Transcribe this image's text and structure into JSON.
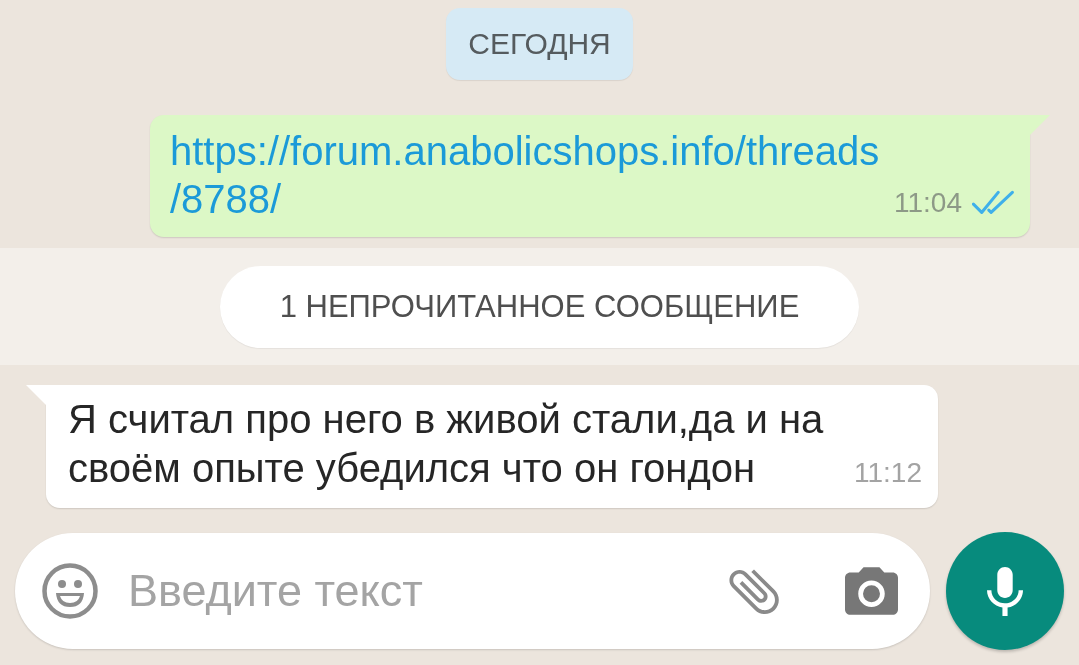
{
  "chat": [
    {
      "kind": "date_chip",
      "label": "СЕГОДНЯ"
    },
    {
      "kind": "outgoing",
      "link": "https://forum.anabolicshops.info/threads/8788/",
      "time": "11:04",
      "read": true
    },
    {
      "kind": "unread_banner",
      "label": "1 НЕПРОЧИТАННОЕ СООБЩЕНИЕ"
    },
    {
      "kind": "incoming",
      "text": "Я считал про него в живой стали,да и на своём опыте убедился что он гондон",
      "time": "11:12"
    }
  ],
  "composer": {
    "placeholder": "Введите текст"
  }
}
